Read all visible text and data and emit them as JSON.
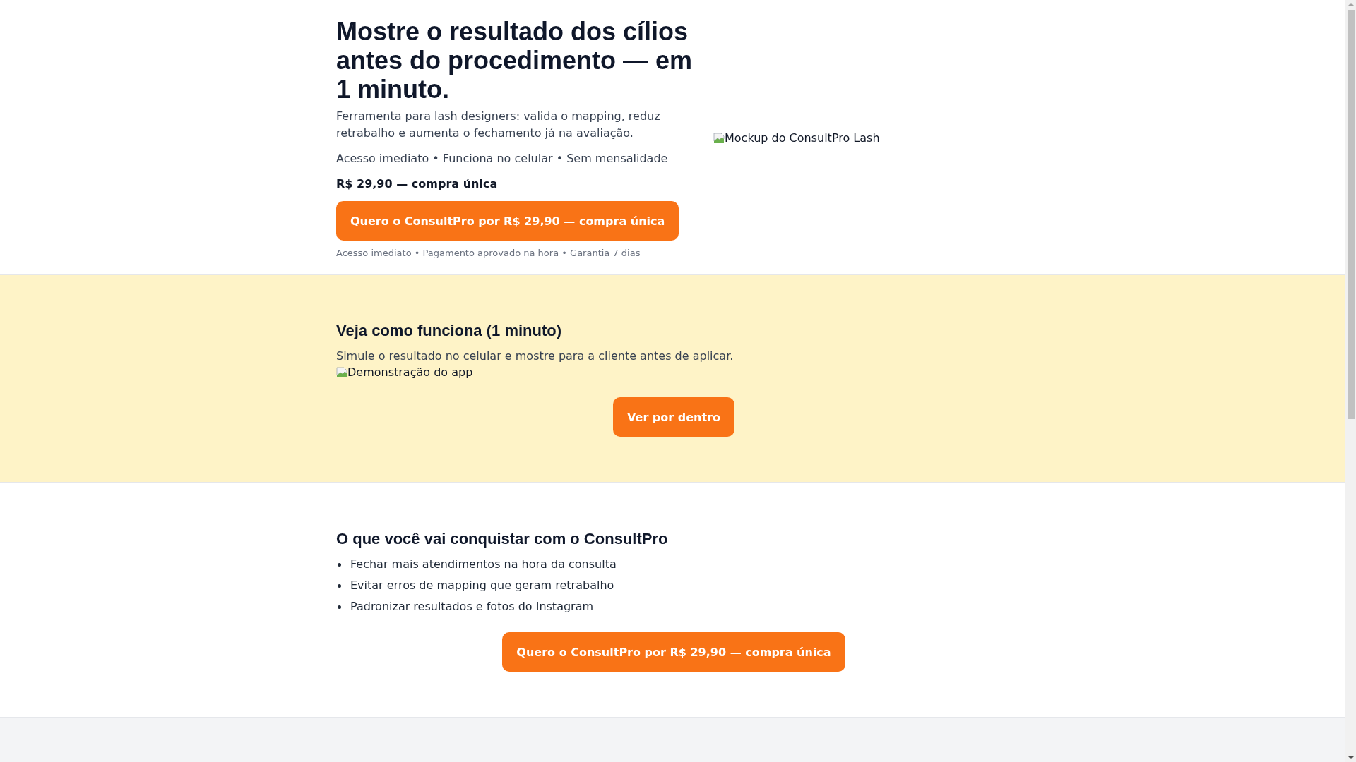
{
  "hero": {
    "title": "Mostre o resultado dos cílios antes do procedimento — em 1 minuto.",
    "subtitle": "Ferramenta para lash designers: valida o mapping, reduz retrabalho e aumenta o fechamento já na avaliação.",
    "features": "Acesso imediato • Funciona no celular • Sem mensalidade",
    "price": "R$ 29,90 — compra única",
    "cta": "Quero o ConsultPro por R$ 29,90 — compra única",
    "note": "Acesso imediato • Pagamento aprovado na hora • Garantia 7 dias",
    "image_alt": "Mockup do ConsultPro Lash"
  },
  "demo": {
    "title": "Veja como funciona (1 minuto)",
    "subtitle": "Simule o resultado no celular e mostre para a cliente antes de aplicar.",
    "image_alt": "Demonstração do app",
    "button": "Ver por dentro"
  },
  "benefits": {
    "title": "O que você vai conquistar com o ConsultPro",
    "items": [
      "Fechar mais atendimentos na hora da consulta",
      "Evitar erros de mapping que geram retrabalho",
      "Padronizar resultados e fotos do Instagram"
    ],
    "cta": "Quero o ConsultPro por R$ 29,90 — compra única"
  }
}
